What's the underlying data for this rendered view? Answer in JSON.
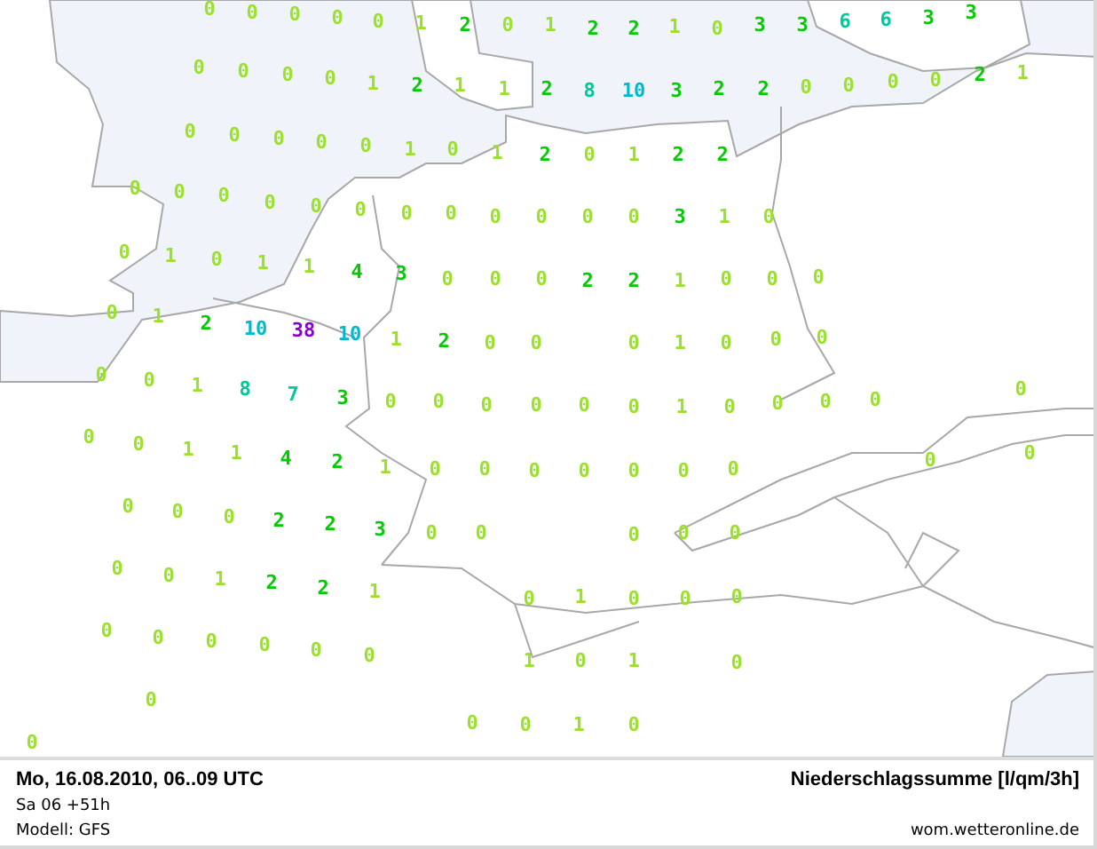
{
  "map": {
    "rows": [
      {
        "values": [
          {
            "text": "0",
            "color": "#9ae02c"
          },
          {
            "text": "0",
            "color": "#9ae02c"
          },
          {
            "text": "0",
            "color": "#9ae02c"
          },
          {
            "text": "0",
            "color": "#9ae02c"
          },
          {
            "text": "0",
            "color": "#9ae02c"
          },
          {
            "text": "1",
            "color": "#9ae02c"
          },
          {
            "text": "2",
            "color": "#00cc00"
          },
          {
            "text": "0",
            "color": "#9ae02c"
          },
          {
            "text": "1",
            "color": "#9ae02c"
          },
          {
            "text": "2",
            "color": "#00cc00"
          },
          {
            "text": "2",
            "color": "#00cc00"
          },
          {
            "text": "1",
            "color": "#9ae02c"
          },
          {
            "text": "0",
            "color": "#9ae02c"
          },
          {
            "text": "3",
            "color": "#00cc00"
          },
          {
            "text": "3",
            "color": "#00cc00"
          },
          {
            "text": "6",
            "color": "#00c89a"
          },
          {
            "text": "6",
            "color": "#00c89a"
          },
          {
            "text": "3",
            "color": "#00cc00"
          },
          {
            "text": "3",
            "color": "#00cc00"
          }
        ]
      },
      {
        "values": [
          {
            "text": "0",
            "color": "#9ae02c"
          },
          {
            "text": "0",
            "color": "#9ae02c"
          },
          {
            "text": "0",
            "color": "#9ae02c"
          },
          {
            "text": "0",
            "color": "#9ae02c"
          },
          {
            "text": "1",
            "color": "#9ae02c"
          },
          {
            "text": "2",
            "color": "#00cc00"
          },
          {
            "text": "1",
            "color": "#9ae02c"
          },
          {
            "text": "1",
            "color": "#9ae02c"
          },
          {
            "text": "2",
            "color": "#00cc00"
          },
          {
            "text": "8",
            "color": "#00c89a"
          },
          {
            "text": "10",
            "color": "#00b8cc"
          },
          {
            "text": "3",
            "color": "#00cc00"
          },
          {
            "text": "2",
            "color": "#00cc00"
          },
          {
            "text": "2",
            "color": "#00cc00"
          },
          {
            "text": "0",
            "color": "#9ae02c"
          },
          {
            "text": "0",
            "color": "#9ae02c"
          },
          {
            "text": "0",
            "color": "#9ae02c"
          },
          {
            "text": "0",
            "color": "#9ae02c"
          },
          {
            "text": "2",
            "color": "#00cc00"
          },
          {
            "text": "1",
            "color": "#9ae02c"
          }
        ]
      },
      {
        "values": [
          {
            "text": "0",
            "color": "#9ae02c"
          },
          {
            "text": "0",
            "color": "#9ae02c"
          },
          {
            "text": "0",
            "color": "#9ae02c"
          },
          {
            "text": "0",
            "color": "#9ae02c"
          },
          {
            "text": "0",
            "color": "#9ae02c"
          },
          {
            "text": "1",
            "color": "#9ae02c"
          },
          {
            "text": "0",
            "color": "#9ae02c"
          },
          {
            "text": "1",
            "color": "#9ae02c"
          },
          {
            "text": "2",
            "color": "#00cc00"
          },
          {
            "text": "0",
            "color": "#9ae02c"
          },
          {
            "text": "1",
            "color": "#9ae02c"
          },
          {
            "text": "2",
            "color": "#00cc00"
          },
          {
            "text": "2",
            "color": "#00cc00"
          }
        ]
      },
      {
        "values": [
          {
            "text": "0",
            "color": "#9ae02c"
          },
          {
            "text": "0",
            "color": "#9ae02c"
          },
          {
            "text": "0",
            "color": "#9ae02c"
          },
          {
            "text": "0",
            "color": "#9ae02c"
          },
          {
            "text": "0",
            "color": "#9ae02c"
          },
          {
            "text": "0",
            "color": "#9ae02c"
          },
          {
            "text": "0",
            "color": "#9ae02c"
          },
          {
            "text": "0",
            "color": "#9ae02c"
          },
          {
            "text": "0",
            "color": "#9ae02c"
          },
          {
            "text": "0",
            "color": "#9ae02c"
          },
          {
            "text": "0",
            "color": "#9ae02c"
          },
          {
            "text": "0",
            "color": "#9ae02c"
          },
          {
            "text": "3",
            "color": "#00cc00"
          },
          {
            "text": "1",
            "color": "#9ae02c"
          },
          {
            "text": "0",
            "color": "#9ae02c"
          }
        ]
      },
      {
        "values": [
          {
            "text": "0",
            "color": "#9ae02c"
          },
          {
            "text": "1",
            "color": "#9ae02c"
          },
          {
            "text": "0",
            "color": "#9ae02c"
          },
          {
            "text": "1",
            "color": "#9ae02c"
          },
          {
            "text": "1",
            "color": "#9ae02c"
          },
          {
            "text": "4",
            "color": "#00cc00"
          },
          {
            "text": "3",
            "color": "#00cc00"
          },
          {
            "text": "0",
            "color": "#9ae02c"
          },
          {
            "text": "0",
            "color": "#9ae02c"
          },
          {
            "text": "0",
            "color": "#9ae02c"
          },
          {
            "text": "2",
            "color": "#00cc00"
          },
          {
            "text": "2",
            "color": "#00cc00"
          },
          {
            "text": "1",
            "color": "#9ae02c"
          },
          {
            "text": "0",
            "color": "#9ae02c"
          },
          {
            "text": "0",
            "color": "#9ae02c"
          },
          {
            "text": "0",
            "color": "#9ae02c"
          }
        ]
      },
      {
        "values": [
          {
            "text": "0",
            "color": "#9ae02c"
          },
          {
            "text": "1",
            "color": "#9ae02c"
          },
          {
            "text": "2",
            "color": "#00cc00"
          },
          {
            "text": "10",
            "color": "#00b8cc"
          },
          {
            "text": "38",
            "color": "#8a00d0"
          },
          {
            "text": "10",
            "color": "#00b8cc"
          },
          {
            "text": "1",
            "color": "#9ae02c"
          },
          {
            "text": "2",
            "color": "#00cc00"
          },
          {
            "text": "0",
            "color": "#9ae02c"
          },
          {
            "text": "0",
            "color": "#9ae02c"
          },
          {
            "text": "0",
            "color": "#9ae02c"
          },
          {
            "text": "1",
            "color": "#9ae02c"
          },
          {
            "text": "0",
            "color": "#9ae02c"
          },
          {
            "text": "0",
            "color": "#9ae02c"
          },
          {
            "text": "0",
            "color": "#9ae02c"
          }
        ]
      },
      {
        "values": [
          {
            "text": "0",
            "color": "#9ae02c"
          },
          {
            "text": "0",
            "color": "#9ae02c"
          },
          {
            "text": "1",
            "color": "#9ae02c"
          },
          {
            "text": "8",
            "color": "#00c89a"
          },
          {
            "text": "7",
            "color": "#00c89a"
          },
          {
            "text": "3",
            "color": "#00cc00"
          },
          {
            "text": "0",
            "color": "#9ae02c"
          },
          {
            "text": "0",
            "color": "#9ae02c"
          },
          {
            "text": "0",
            "color": "#9ae02c"
          },
          {
            "text": "0",
            "color": "#9ae02c"
          },
          {
            "text": "0",
            "color": "#9ae02c"
          },
          {
            "text": "0",
            "color": "#9ae02c"
          },
          {
            "text": "1",
            "color": "#9ae02c"
          },
          {
            "text": "0",
            "color": "#9ae02c"
          },
          {
            "text": "0",
            "color": "#9ae02c"
          },
          {
            "text": "0",
            "color": "#9ae02c"
          },
          {
            "text": "0",
            "color": "#9ae02c"
          },
          {
            "text": "0",
            "color": "#9ae02c"
          }
        ]
      },
      {
        "values": [
          {
            "text": "0",
            "color": "#9ae02c"
          },
          {
            "text": "0",
            "color": "#9ae02c"
          },
          {
            "text": "1",
            "color": "#9ae02c"
          },
          {
            "text": "1",
            "color": "#9ae02c"
          },
          {
            "text": "4",
            "color": "#00cc00"
          },
          {
            "text": "2",
            "color": "#00cc00"
          },
          {
            "text": "1",
            "color": "#9ae02c"
          },
          {
            "text": "0",
            "color": "#9ae02c"
          },
          {
            "text": "0",
            "color": "#9ae02c"
          },
          {
            "text": "0",
            "color": "#9ae02c"
          },
          {
            "text": "0",
            "color": "#9ae02c"
          },
          {
            "text": "0",
            "color": "#9ae02c"
          },
          {
            "text": "0",
            "color": "#9ae02c"
          },
          {
            "text": "0",
            "color": "#9ae02c"
          },
          {
            "text": "0",
            "color": "#9ae02c"
          },
          {
            "text": "0",
            "color": "#9ae02c"
          }
        ]
      },
      {
        "values": [
          {
            "text": "0",
            "color": "#9ae02c"
          },
          {
            "text": "0",
            "color": "#9ae02c"
          },
          {
            "text": "0",
            "color": "#9ae02c"
          },
          {
            "text": "2",
            "color": "#00cc00"
          },
          {
            "text": "2",
            "color": "#00cc00"
          },
          {
            "text": "3",
            "color": "#00cc00"
          },
          {
            "text": "0",
            "color": "#9ae02c"
          },
          {
            "text": "0",
            "color": "#9ae02c"
          },
          {
            "text": "0",
            "color": "#9ae02c"
          },
          {
            "text": "0",
            "color": "#9ae02c"
          },
          {
            "text": "0",
            "color": "#9ae02c"
          }
        ]
      },
      {
        "values": [
          {
            "text": "0",
            "color": "#9ae02c"
          },
          {
            "text": "0",
            "color": "#9ae02c"
          },
          {
            "text": "1",
            "color": "#9ae02c"
          },
          {
            "text": "2",
            "color": "#00cc00"
          },
          {
            "text": "2",
            "color": "#00cc00"
          },
          {
            "text": "1",
            "color": "#9ae02c"
          },
          {
            "text": "0",
            "color": "#9ae02c"
          },
          {
            "text": "1",
            "color": "#9ae02c"
          },
          {
            "text": "0",
            "color": "#9ae02c"
          },
          {
            "text": "0",
            "color": "#9ae02c"
          },
          {
            "text": "0",
            "color": "#9ae02c"
          }
        ]
      },
      {
        "values": [
          {
            "text": "0",
            "color": "#9ae02c"
          },
          {
            "text": "0",
            "color": "#9ae02c"
          },
          {
            "text": "0",
            "color": "#9ae02c"
          },
          {
            "text": "0",
            "color": "#9ae02c"
          },
          {
            "text": "0",
            "color": "#9ae02c"
          },
          {
            "text": "0",
            "color": "#9ae02c"
          },
          {
            "text": "1",
            "color": "#9ae02c"
          },
          {
            "text": "0",
            "color": "#9ae02c"
          },
          {
            "text": "1",
            "color": "#9ae02c"
          },
          {
            "text": "0",
            "color": "#9ae02c"
          }
        ]
      },
      {
        "values": [
          {
            "text": "0",
            "color": "#9ae02c"
          },
          {
            "text": "0",
            "color": "#9ae02c"
          },
          {
            "text": "0",
            "color": "#9ae02c"
          },
          {
            "text": "1",
            "color": "#9ae02c"
          },
          {
            "text": "0",
            "color": "#9ae02c"
          },
          {
            "text": "0",
            "color": "#9ae02c"
          }
        ]
      }
    ]
  },
  "footer": {
    "date": "Mo, 16.08.2010, 06..09 UTC",
    "run": "Sa 06 +51h",
    "model": "Modell: GFS",
    "title": "Niederschlagssumme [l/qm/3h]",
    "source": "wom.wetteronline.de"
  }
}
